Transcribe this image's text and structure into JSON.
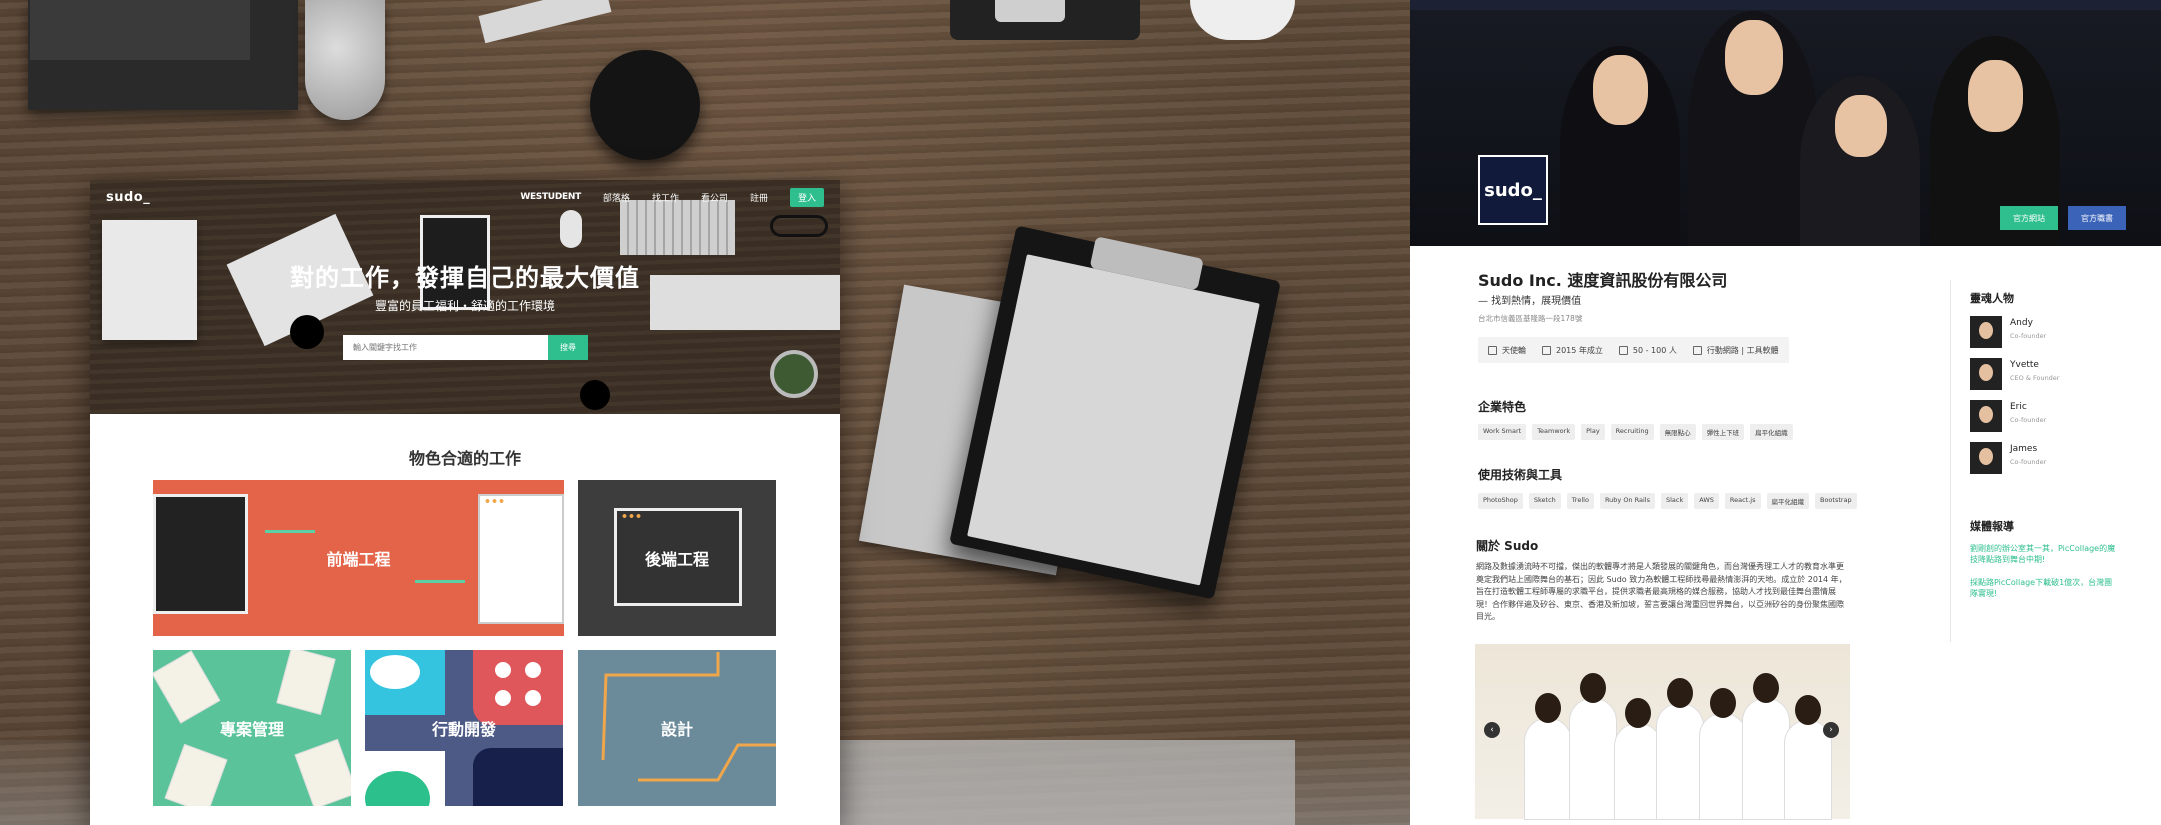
{
  "left": {
    "nav": {
      "logo": "sudo_",
      "links": [
        "WESTUDENT",
        "部落格",
        "找工作",
        "看公司",
        "註冊"
      ],
      "login": "登入"
    },
    "hero": {
      "title": "對的工作，發揮自己的最大價值",
      "subtitle": "豐富的員工福利・舒適的工作環境",
      "search_placeholder": "輸入關鍵字找工作",
      "search_button": "搜尋"
    },
    "section_title": "物色合適的工作",
    "categories": [
      "前端工程",
      "後端工程",
      "專案管理",
      "行動開發",
      "設計"
    ],
    "colors": {
      "accent": "#2fbf8f",
      "frontend": "#e4644a",
      "backend": "#3d3d3d",
      "pm": "#5ac39a",
      "mobile": "#4d5a86",
      "design": "#6b8a9a"
    }
  },
  "right": {
    "logo": "sudo_",
    "buttons": {
      "website": "官方網站",
      "jobs": "官方職書"
    },
    "company": {
      "name": "Sudo Inc. 速度資訊股份有限公司",
      "tagline": "— 找到熱情，展現價值",
      "address": "台北市信義區基隆路一段178號"
    },
    "facts": [
      {
        "icon": "chart-icon",
        "text": "天使輪"
      },
      {
        "icon": "calendar-icon",
        "text": "2015 年成立"
      },
      {
        "icon": "building-icon",
        "text": "50 - 100 人"
      },
      {
        "icon": "tag-icon",
        "text": "行動網路 | 工具軟體"
      }
    ],
    "features_title": "企業特色",
    "features": [
      "Work Smart",
      "Teamwork",
      "Play",
      "Recruiting",
      "無限點心",
      "彈性上下班",
      "扁平化組織"
    ],
    "tech_title": "使用技術與工具",
    "tech": [
      "PhotoShop",
      "Sketch",
      "Trello",
      "Ruby On Rails",
      "Slack",
      "AWS",
      "React.js",
      "扁平化組織",
      "Bootstrap"
    ],
    "about_title": "關於 Sudo",
    "about_text": "網路及數據湧流時不可擋，傑出的軟體專才將是人類發展的關鍵角色，而台灣優秀理工人才的教育水準更奠定我們站上國際舞台的基石；因此 Sudo 致力為軟體工程師找尋最熱情澎湃的天地。成立於 2014 年，旨在打造軟體工程師專屬的求職平台，提供求職者最高規格的媒合服務，協助人才找到最佳舞台盡情展現！合作夥伴遍及矽谷、東京、香港及新加坡，誓言要讓台灣重回世界舞台，以亞洲矽谷的身份聚焦國際目光。",
    "people_title": "靈魂人物",
    "people": [
      {
        "name": "Andy",
        "role": "Co-founder"
      },
      {
        "name": "Yvette",
        "role": "CEO & Founder"
      },
      {
        "name": "Eric",
        "role": "Co-founder"
      },
      {
        "name": "James",
        "role": "Co-founder"
      }
    ],
    "media_title": "媒體報導",
    "media": [
      "劉剛創的辦公室其一其，PicCollage的魔技降點路到舞台中期!",
      "採點路PicCollage下載破1億次，台灣團隊實現!"
    ],
    "colors": {
      "accent": "#2fbf8f",
      "blue_button": "#3b63b8",
      "logo_bg": "#111a3a"
    }
  }
}
